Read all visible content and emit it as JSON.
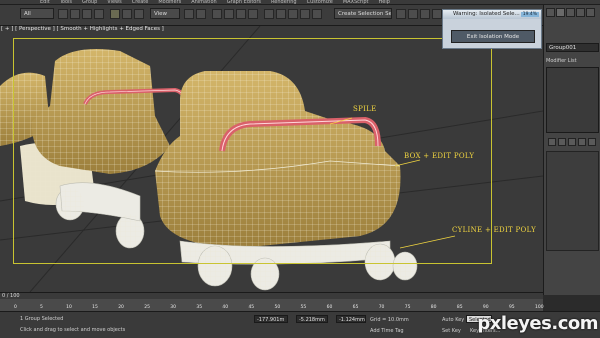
{
  "menu": {
    "items": [
      "Edit",
      "Tools",
      "Group",
      "Views",
      "Create",
      "Modifiers",
      "Animation",
      "Graph Editors",
      "Rendering",
      "Customize",
      "MAXScript",
      "Help"
    ]
  },
  "toolbar": {
    "selection_filter": "All",
    "reference_coord": "View",
    "named_selection": "Create Selection Se"
  },
  "viewport": {
    "label": "[ + ] [ Perspective ] [ Smooth + Highlights + Edged Faces ]"
  },
  "annotations": {
    "spile": "SPILE",
    "box_edit_poly": "BOX + EDIT POLY",
    "cyline_edit_poly": "CYLINE + EDIT POLY"
  },
  "isolation_dialog": {
    "title": "Warning: Isolated Sele...",
    "exit_button": "Exit Isolation Mode",
    "percent": "19.4%"
  },
  "command_panel": {
    "object_name": "Group001",
    "modifier_list_label": "Modifier List"
  },
  "timeslider": {
    "label": "0 / 100"
  },
  "ruler": {
    "ticks": [
      "0",
      "5",
      "10",
      "15",
      "20",
      "25",
      "30",
      "35",
      "40",
      "45",
      "50",
      "55",
      "60",
      "65",
      "70",
      "75",
      "80",
      "85",
      "90",
      "95",
      "100"
    ]
  },
  "status": {
    "selection_count": "1 Group Selected",
    "prompt": "Click and drag to select and move objects",
    "x_value": "-177.901m",
    "y_value": "-5.218mm",
    "z_value": "-1.124mm",
    "grid": "Grid = 10.0mm",
    "add_time_tag": "Add Time Tag",
    "auto_key": "Auto Key",
    "selected": "Selected",
    "set_key": "Set Key",
    "key_filters": "Key Filters..."
  },
  "watermark": "pxleyes.com",
  "colors": {
    "accent_yellow": "#c9c431",
    "annotation": "#f2d640",
    "body_tan": "#c2a45a",
    "handle_red": "#d9616a"
  }
}
